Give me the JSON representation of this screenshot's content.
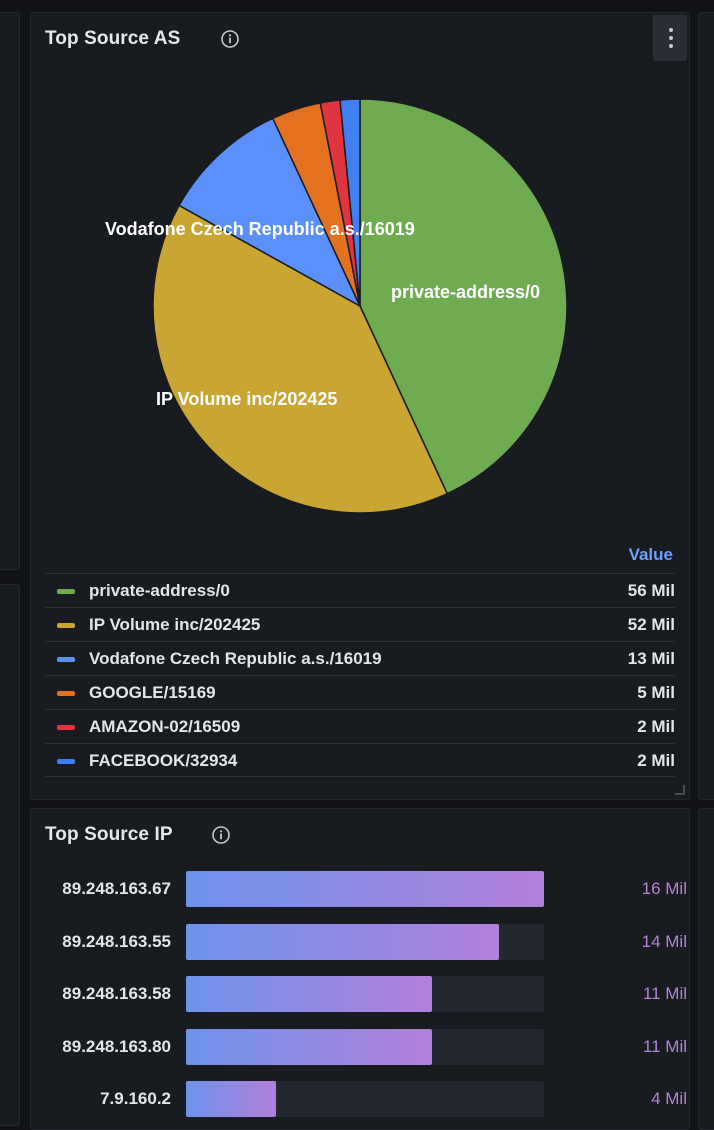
{
  "top_source_as": {
    "title": "Top Source AS",
    "legend_header": "Value",
    "slices": [
      {
        "name": "private-address/0",
        "value": 56,
        "display": "56 Mil",
        "color": "#6fab50",
        "show_label": true
      },
      {
        "name": "IP Volume inc/202425",
        "value": 52,
        "display": "52 Mil",
        "color": "#c9a533",
        "show_label": true
      },
      {
        "name": "Vodafone Czech Republic a.s./16019",
        "value": 13,
        "display": "13 Mil",
        "color": "#5b8ff9",
        "show_label": true
      },
      {
        "name": "GOOGLE/15169",
        "value": 5,
        "display": "5 Mil",
        "color": "#e3711f",
        "show_label": false
      },
      {
        "name": "AMAZON-02/16509",
        "value": 2,
        "display": "2 Mil",
        "color": "#e0343f",
        "show_label": false
      },
      {
        "name": "FACEBOOK/32934",
        "value": 2,
        "display": "2 Mil",
        "color": "#3f7ff2",
        "show_label": false
      }
    ]
  },
  "top_source_ip": {
    "title": "Top Source IP",
    "max": 16,
    "rows": [
      {
        "ip": "89.248.163.67",
        "value": 16,
        "display": "16 Mil"
      },
      {
        "ip": "89.248.163.55",
        "value": 14,
        "display": "14 Mil"
      },
      {
        "ip": "89.248.163.58",
        "value": 11,
        "display": "11 Mil"
      },
      {
        "ip": "89.248.163.80",
        "value": 11,
        "display": "11 Mil"
      },
      {
        "ip": "7.9.160.2",
        "value": 4,
        "display": "4 Mil"
      }
    ]
  },
  "chart_data": [
    {
      "type": "pie",
      "title": "Top Source AS",
      "categories": [
        "private-address/0",
        "IP Volume inc/202425",
        "Vodafone Czech Republic a.s./16019",
        "GOOGLE/15169",
        "AMAZON-02/16509",
        "FACEBOOK/32934"
      ],
      "values": [
        56,
        52,
        13,
        5,
        2,
        2
      ],
      "unit": "Mil",
      "legend": "bottom"
    },
    {
      "type": "bar",
      "orientation": "horizontal",
      "title": "Top Source IP",
      "categories": [
        "89.248.163.67",
        "89.248.163.55",
        "89.248.163.58",
        "89.248.163.80",
        "7.9.160.2"
      ],
      "values": [
        16,
        14,
        11,
        11,
        4
      ],
      "unit": "Mil"
    }
  ]
}
